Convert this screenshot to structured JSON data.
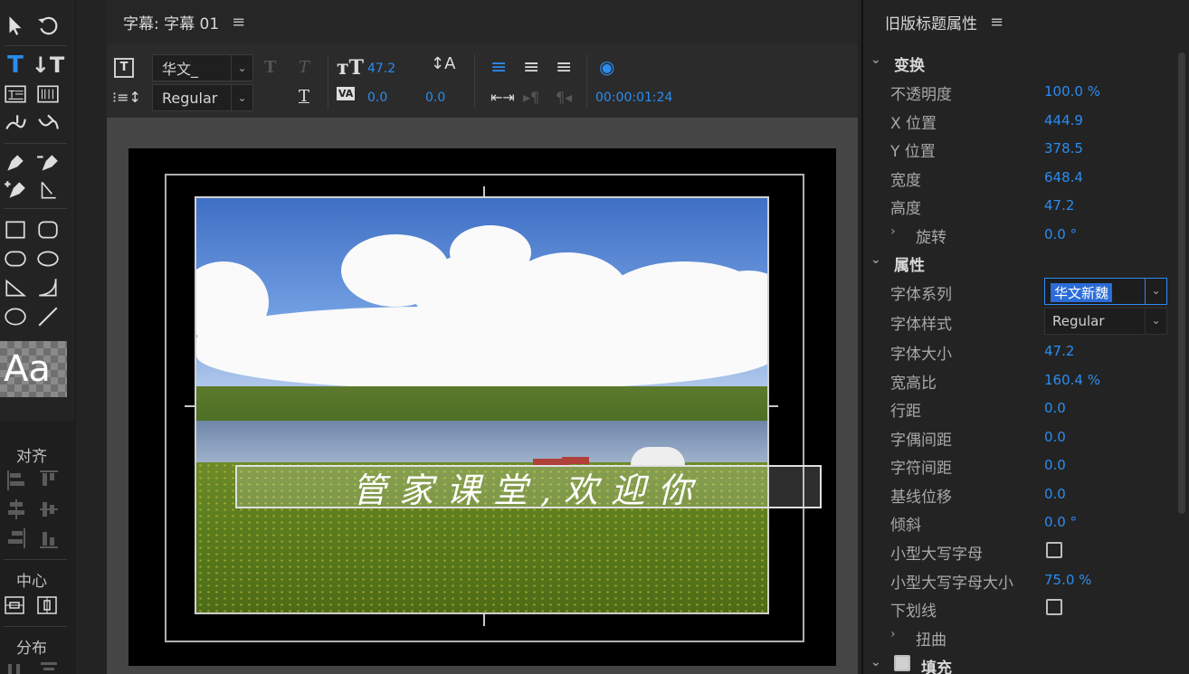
{
  "editor": {
    "title": "字幕: 字幕 01",
    "font_family": "华文_",
    "font_style": "Regular",
    "font_size": "47.2",
    "kerning": "0.0",
    "leading": "0.0",
    "tracking": "0.0",
    "timecode": "00:00:01:24",
    "caption_text": "管家课堂,欢迎你"
  },
  "tools": {
    "align_label": "对齐",
    "center_label": "中心",
    "distribute_label": "分布",
    "sample_text": "Aa"
  },
  "props": {
    "title": "旧版标题属性",
    "transform_label": "变换",
    "opacity": {
      "label": "不透明度",
      "value": "100.0 %"
    },
    "x_pos": {
      "label": "X 位置",
      "value": "444.9"
    },
    "y_pos": {
      "label": "Y 位置",
      "value": "378.5"
    },
    "width": {
      "label": "宽度",
      "value": "648.4"
    },
    "height": {
      "label": "高度",
      "value": "47.2"
    },
    "rotation": {
      "label": "旋转",
      "value": "0.0 °"
    },
    "attributes_label": "属性",
    "font_family": {
      "label": "字体系列",
      "value": "华文新魏"
    },
    "font_style": {
      "label": "字体样式",
      "value": "Regular"
    },
    "font_size": {
      "label": "字体大小",
      "value": "47.2"
    },
    "aspect": {
      "label": "宽高比",
      "value": "160.4 %"
    },
    "leading": {
      "label": "行距",
      "value": "0.0"
    },
    "kerning": {
      "label": "字偶间距",
      "value": "0.0"
    },
    "tracking": {
      "label": "字符间距",
      "value": "0.0"
    },
    "baseline": {
      "label": "基线位移",
      "value": "0.0"
    },
    "slant": {
      "label": "倾斜",
      "value": "0.0 °"
    },
    "small_caps": {
      "label": "小型大写字母"
    },
    "small_caps_size": {
      "label": "小型大写字母大小",
      "value": "75.0 %"
    },
    "underline": {
      "label": "下划线"
    },
    "distort": {
      "label": "扭曲"
    },
    "fill": {
      "label": "填充"
    }
  }
}
